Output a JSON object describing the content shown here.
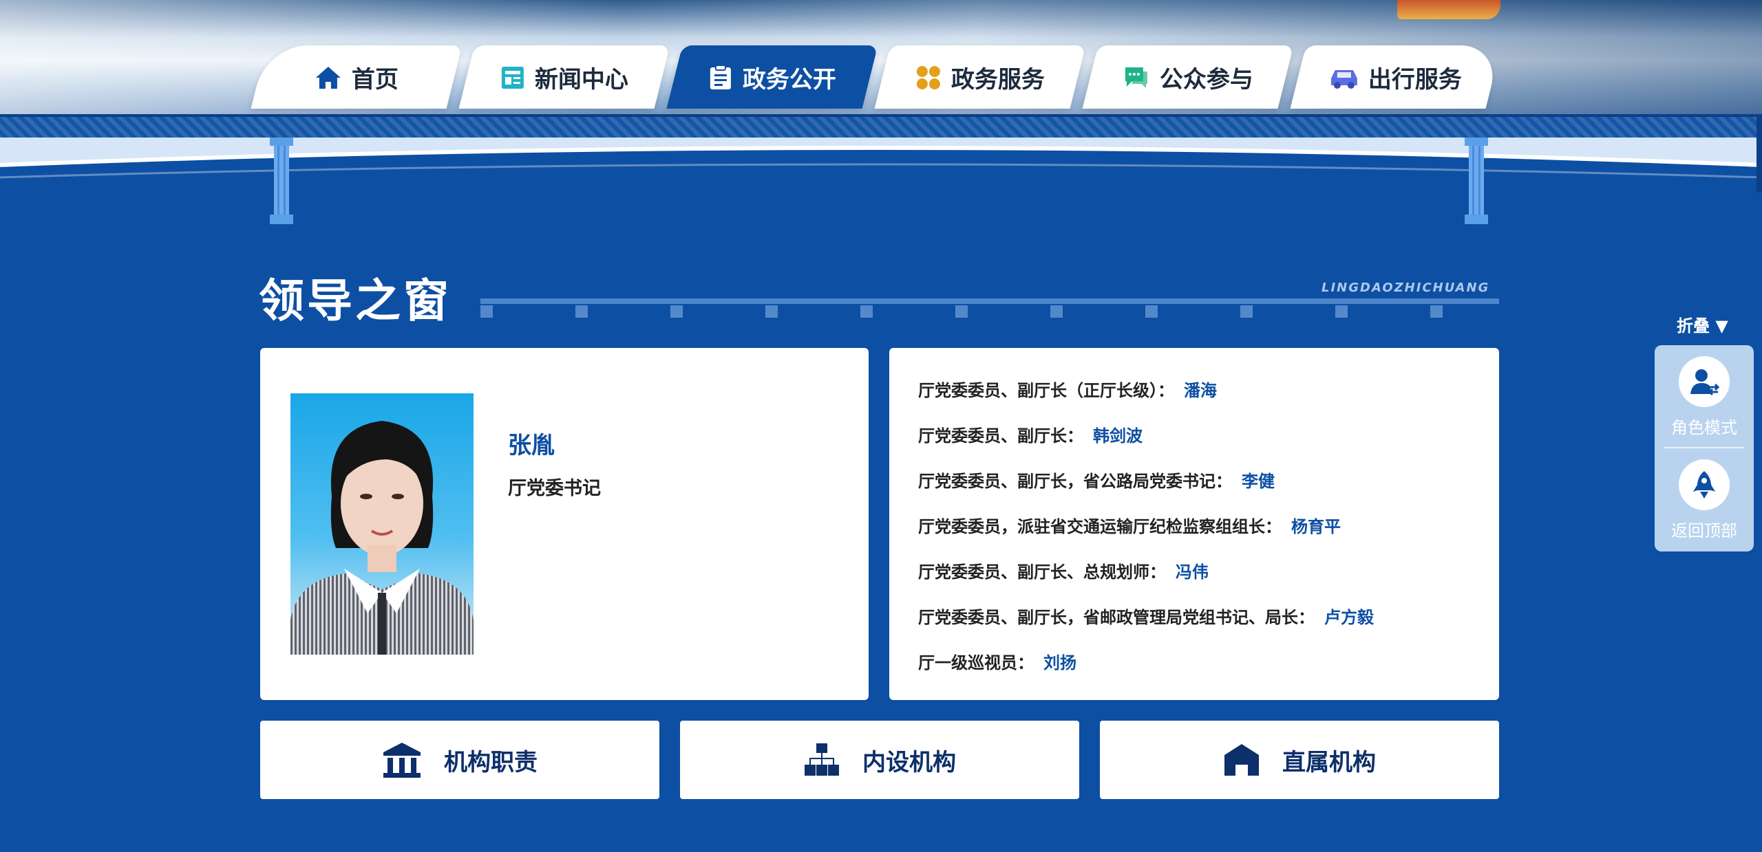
{
  "nav": {
    "tabs": [
      {
        "label": "首页",
        "icon": "home-icon",
        "color": "#0d4fa3"
      },
      {
        "label": "新闻中心",
        "icon": "news-icon",
        "color": "#1fb3c7"
      },
      {
        "label": "政务公开",
        "icon": "document-icon",
        "color": "#ffffff",
        "active": true
      },
      {
        "label": "政务服务",
        "icon": "grid-icon",
        "color": "#e3a11a"
      },
      {
        "label": "公众参与",
        "icon": "chat-icon",
        "color": "#1fb38a"
      },
      {
        "label": "出行服务",
        "icon": "car-icon",
        "color": "#5b6fe0"
      }
    ]
  },
  "section": {
    "title": "领导之窗",
    "subtitle": "LINGDAOZHICHUANG"
  },
  "leader": {
    "name": "张胤",
    "title": "厅党委书记"
  },
  "leaders": [
    {
      "role": "厅党委委员、副厅长（正厅长级）：",
      "name": "潘海"
    },
    {
      "role": "厅党委委员、副厅长：",
      "name": "韩剑波"
    },
    {
      "role": "厅党委委员、副厅长，省公路局党委书记：",
      "name": "李健"
    },
    {
      "role": "厅党委委员，派驻省交通运输厅纪检监察组组长：",
      "name": "杨育平"
    },
    {
      "role": "厅党委委员、副厅长、总规划师：",
      "name": "冯伟"
    },
    {
      "role": "厅党委委员、副厅长，省邮政管理局党组书记、局长：",
      "name": "卢方毅"
    },
    {
      "role": "厅一级巡视员：",
      "name": "刘扬"
    }
  ],
  "buttons": [
    {
      "label": "机构职责",
      "icon": "institution-icon"
    },
    {
      "label": "内设机构",
      "icon": "org-chart-icon"
    },
    {
      "label": "直属机构",
      "icon": "building-icon"
    }
  ],
  "sidebar": {
    "fold_label": "折叠",
    "items": [
      {
        "label": "角色模式",
        "icon": "user-switch-icon"
      },
      {
        "label": "返回顶部",
        "icon": "rocket-icon"
      }
    ]
  },
  "colors": {
    "primary": "#0d4fa3",
    "accent": "#1fb3c7"
  }
}
